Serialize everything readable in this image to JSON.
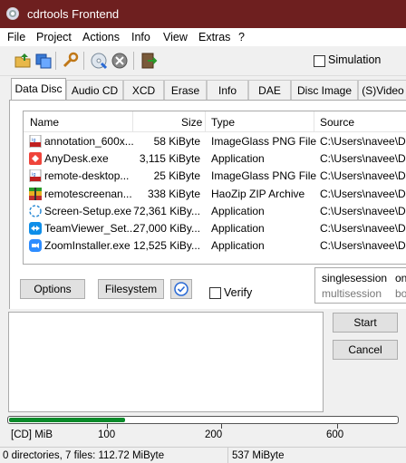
{
  "window": {
    "title": "cdrtools Frontend"
  },
  "menu": [
    "File",
    "Project",
    "Actions",
    "Info",
    "View",
    "Extras",
    "?"
  ],
  "toolbar": {
    "simulation_label": "Simulation",
    "simulation_checked": false
  },
  "tabs": [
    "Data Disc",
    "Audio CD",
    "XCD",
    "Erase",
    "Info",
    "DAE",
    "Disc Image",
    "(S)Video"
  ],
  "list": {
    "columns": [
      "Name",
      "Size",
      "Type",
      "Source"
    ],
    "rows": [
      {
        "name": "annotation_600x...",
        "size": "58 KiByte",
        "type": "ImageGlass PNG File",
        "source": "C:\\Users\\navee\\Do",
        "icon": "png-file-icon"
      },
      {
        "name": "AnyDesk.exe",
        "size": "3,115 KiByte",
        "type": "Application",
        "source": "C:\\Users\\navee\\Do",
        "icon": "anydesk-icon"
      },
      {
        "name": "remote-desktop...",
        "size": "25 KiByte",
        "type": "ImageGlass PNG File",
        "source": "C:\\Users\\navee\\Do",
        "icon": "png-file-icon"
      },
      {
        "name": "remotescreenan...",
        "size": "338 KiByte",
        "type": "HaoZip ZIP Archive",
        "source": "C:\\Users\\navee\\Do",
        "icon": "zip-archive-icon"
      },
      {
        "name": "Screen-Setup.exe",
        "size": "72,361 KiBy...",
        "type": "Application",
        "source": "C:\\Users\\navee\\Do",
        "icon": "setup-icon"
      },
      {
        "name": "TeamViewer_Set...",
        "size": "27,000 KiBy...",
        "type": "Application",
        "source": "C:\\Users\\navee\\Do",
        "icon": "teamviewer-icon"
      },
      {
        "name": "ZoomInstaller.exe",
        "size": "12,525 KiBy...",
        "type": "Application",
        "source": "C:\\Users\\navee\\Do",
        "icon": "zoom-icon"
      }
    ]
  },
  "buttons": {
    "options": "Options",
    "filesystem": "Filesystem",
    "verify": "Verify",
    "start": "Start",
    "cancel": "Cancel"
  },
  "session": {
    "line1a": "singlesession",
    "line1b": "on",
    "line2a": "multisession",
    "line2b": "bo"
  },
  "capacity": {
    "unit": "[CD] MiB",
    "ticks": [
      "100",
      "200",
      "600"
    ],
    "fill_fraction": 0.3
  },
  "status": {
    "left": "0 directories, 7 files: 112.72 MiByte",
    "right": "537 MiByte"
  }
}
